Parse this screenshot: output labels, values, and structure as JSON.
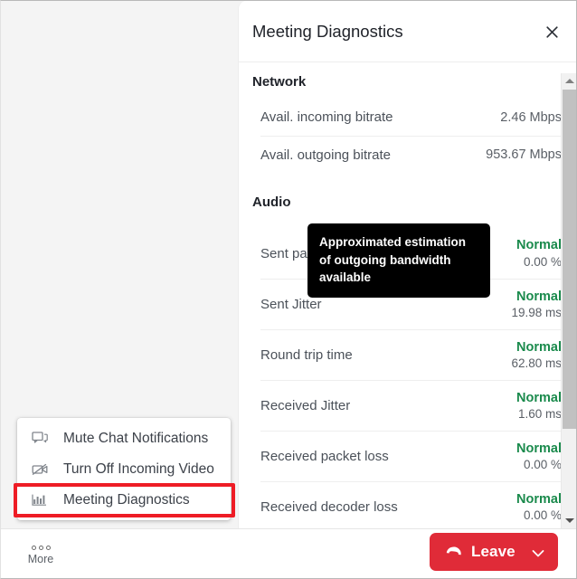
{
  "colors": {
    "accent_red": "#e02b38",
    "status_green": "#1a8a4c",
    "highlight_box": "#ee1c25",
    "panel_bg": "#ffffff",
    "stage_bg": "#f4f4f4"
  },
  "panel": {
    "title": "Meeting Diagnostics",
    "close_icon": "close-icon",
    "sections": [
      {
        "name": "Network",
        "rows": [
          {
            "label": "Avail. incoming bitrate",
            "value": "2.46 Mbps"
          },
          {
            "label": "Avail. outgoing bitrate",
            "value": "953.67 Mbps"
          }
        ]
      },
      {
        "name": "Audio",
        "rows": [
          {
            "label": "Sent packet loss",
            "status": "Normal",
            "value": "0.00 %"
          },
          {
            "label": "Sent Jitter",
            "status": "Normal",
            "value": "19.98 ms"
          },
          {
            "label": "Round trip time",
            "status": "Normal",
            "value": "62.80 ms"
          },
          {
            "label": "Received Jitter",
            "status": "Normal",
            "value": "1.60 ms"
          },
          {
            "label": "Received packet loss",
            "status": "Normal",
            "value": "0.00 %"
          },
          {
            "label": "Received decoder loss",
            "status": "Normal",
            "value": "0.00 %"
          }
        ]
      }
    ],
    "tooltip": "Approximated estimation of outgoing bandwidth available",
    "scrollbar": {
      "up_arrow": "scroll-up-arrow-icon",
      "down_arrow": "scroll-down-arrow-icon"
    }
  },
  "context_menu": {
    "items": [
      {
        "icon": "chat-bubble-icon",
        "label": "Mute Chat Notifications",
        "highlighted": false
      },
      {
        "icon": "video-off-icon",
        "label": "Turn Off Incoming Video",
        "highlighted": false
      },
      {
        "icon": "bar-chart-icon",
        "label": "Meeting Diagnostics",
        "highlighted": true
      }
    ]
  },
  "control_bar": {
    "more": {
      "label": "More",
      "icon": "more-dots-icon"
    },
    "leave": {
      "label": "Leave",
      "icon": "hang-up-phone-icon",
      "caret": "chevron-down-icon"
    }
  }
}
